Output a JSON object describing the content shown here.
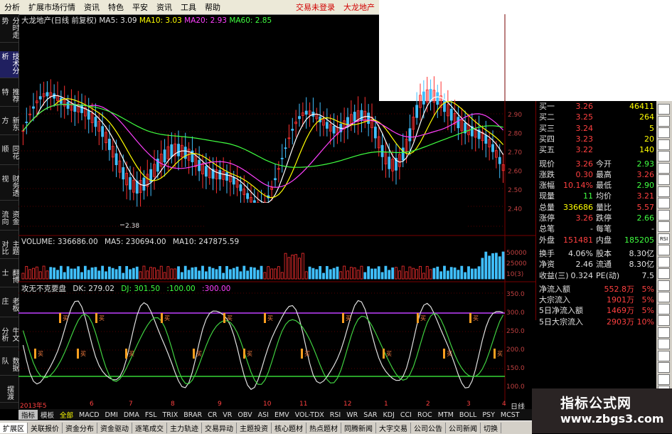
{
  "menu": {
    "items": [
      "分析",
      "扩展市场行情",
      "资讯",
      "特色",
      "平安",
      "资讯",
      "工具",
      "帮助"
    ],
    "login": "交易未登录",
    "stock": "大龙地产"
  },
  "left_tabs": [
    "分时走势",
    "技术分析",
    "推荐特",
    "新东方",
    "同花顺",
    "财务透视",
    "资金流向",
    "主题对比",
    "翻博士",
    "老板庄",
    "牛文分析",
    "数据队",
    "摆渡"
  ],
  "price_panel": {
    "title": "大龙地产(日线 前复权)",
    "ma5": "MA5: 3.09",
    "ma10": "MA10: 3.03",
    "ma20": "MA20: 2.93",
    "ma60": "MA60: 2.85",
    "low_label": "2.38",
    "y_ticks": [
      "2.90",
      "2.80",
      "2.70",
      "2.60",
      "2.50",
      "2.40"
    ]
  },
  "volume_panel": {
    "vol": "VOLUME: 336686.00",
    "ma5": "MA5: 230694.00",
    "ma10": "MA10: 247875.59",
    "y_ticks": [
      "50000",
      "25000",
      "10(3)"
    ]
  },
  "indicator_panel": {
    "name": "攻无不克要盘",
    "dk": "DK: 279.02",
    "dj": "DJ: 301.50",
    "l100": ":100.00",
    "l300": ":300.00",
    "y_ticks": [
      "350.0",
      "300.0",
      "250.0",
      "200.0",
      "150.0",
      "100.0"
    ],
    "buy_label": "买"
  },
  "dates": [
    "2013年5",
    "6",
    "7",
    "8",
    "9",
    "10",
    "11",
    "12",
    "1",
    "2",
    "3",
    "4"
  ],
  "day_k": "日线",
  "quote": {
    "rows": [
      {
        "a": "买一",
        "b": "3.26",
        "d": "46411",
        "bc": "red",
        "dc": "yel"
      },
      {
        "a": "买二",
        "b": "3.25",
        "d": "264",
        "bc": "red",
        "dc": "yel"
      },
      {
        "a": "买三",
        "b": "3.24",
        "d": "5",
        "bc": "red",
        "dc": "yel"
      },
      {
        "a": "买四",
        "b": "3.23",
        "d": "20",
        "bc": "red",
        "dc": "yel"
      },
      {
        "a": "买五",
        "b": "3.22",
        "d": "140",
        "bc": "red",
        "dc": "yel"
      },
      {
        "a": "现价",
        "b": "3.26",
        "c": "今开",
        "d": "2.93",
        "bc": "red",
        "dc": "grn"
      },
      {
        "a": "涨跌",
        "b": "0.30",
        "c": "最高",
        "d": "3.26",
        "bc": "red",
        "dc": "red"
      },
      {
        "a": "涨幅",
        "b": "10.14%",
        "c": "最低",
        "d": "2.90",
        "bc": "red",
        "dc": "grn"
      },
      {
        "a": "现量",
        "b": "11",
        "c": "均价",
        "d": "3.21",
        "bc": "grn",
        "dc": "red"
      },
      {
        "a": "总量",
        "b": "336686",
        "c": "量比",
        "d": "5.57",
        "bc": "yel",
        "dc": "red"
      },
      {
        "a": "涨停",
        "b": "3.26",
        "c": "跌停",
        "d": "2.66",
        "bc": "red",
        "dc": "grn"
      },
      {
        "a": "总笔",
        "b": "-",
        "c": "每笔",
        "d": "-",
        "bc": "wht",
        "dc": "wht"
      },
      {
        "a": "外盘",
        "b": "151481",
        "c": "内盘",
        "d": "185205",
        "bc": "red",
        "dc": "grn"
      },
      {
        "a": "换手",
        "b": "4.06%",
        "c": "股本",
        "d": "8.30亿",
        "bc": "wht",
        "dc": "wht"
      },
      {
        "a": "净资",
        "b": "2.46",
        "c": "流通",
        "d": "8.30亿",
        "bc": "wht",
        "dc": "wht"
      },
      {
        "a": "收益(三)",
        "b": "0.324",
        "c": "PE(动)",
        "d": "7.5",
        "bc": "wht",
        "dc": "wht"
      },
      {
        "a": "净流入额",
        "b": "552.8万",
        "d": "5%",
        "bc": "red",
        "dc": "red"
      },
      {
        "a": "大宗流入",
        "b": "1901万",
        "d": "5%",
        "bc": "red",
        "dc": "red"
      },
      {
        "a": "5日净流入额",
        "b": "1469万",
        "d": "5%",
        "bc": "red",
        "dc": "red"
      },
      {
        "a": "5日大宗流入",
        "b": "2903万",
        "d": "10%",
        "bc": "red",
        "dc": "red"
      }
    ]
  },
  "side_tools": [
    "",
    "",
    "",
    "",
    "",
    "",
    "",
    "",
    "",
    "",
    "",
    "RSI",
    "",
    "",
    "",
    "",
    "",
    "",
    "",
    "",
    "",
    "",
    "",
    "",
    ""
  ],
  "logo": {
    "l1": "指标公式网",
    "l2": "www.zbgs3.com"
  },
  "tabbar": [
    "指标",
    "模板",
    "全部",
    "MACD",
    "DMI",
    "DMA",
    "FSL",
    "TRIX",
    "BRAR",
    "CR",
    "VR",
    "OBV",
    "ASI",
    "EMV",
    "VOL-TDX",
    "RSI",
    "WR",
    "SAR",
    "KDJ",
    "CCI",
    "ROC",
    "MTM",
    "BOLL",
    "PSY",
    "MCST"
  ],
  "bottom": [
    "扩展区",
    "关联报价",
    "资金分布",
    "资金驱动",
    "逐笔成交",
    "主力轨迹",
    "交易异动",
    "主题投资",
    "核心题材",
    "热点题材",
    "同腾新闻",
    "大字交易",
    "公司公告",
    "公司新闻",
    "切换"
  ],
  "colors": {
    "bg": "#000000",
    "up": "#ff3030",
    "down": "#40c0ff",
    "ma5": "#ffffff",
    "ma10": "#ffff00",
    "ma20": "#ff40ff",
    "ma60": "#40ff40"
  }
}
